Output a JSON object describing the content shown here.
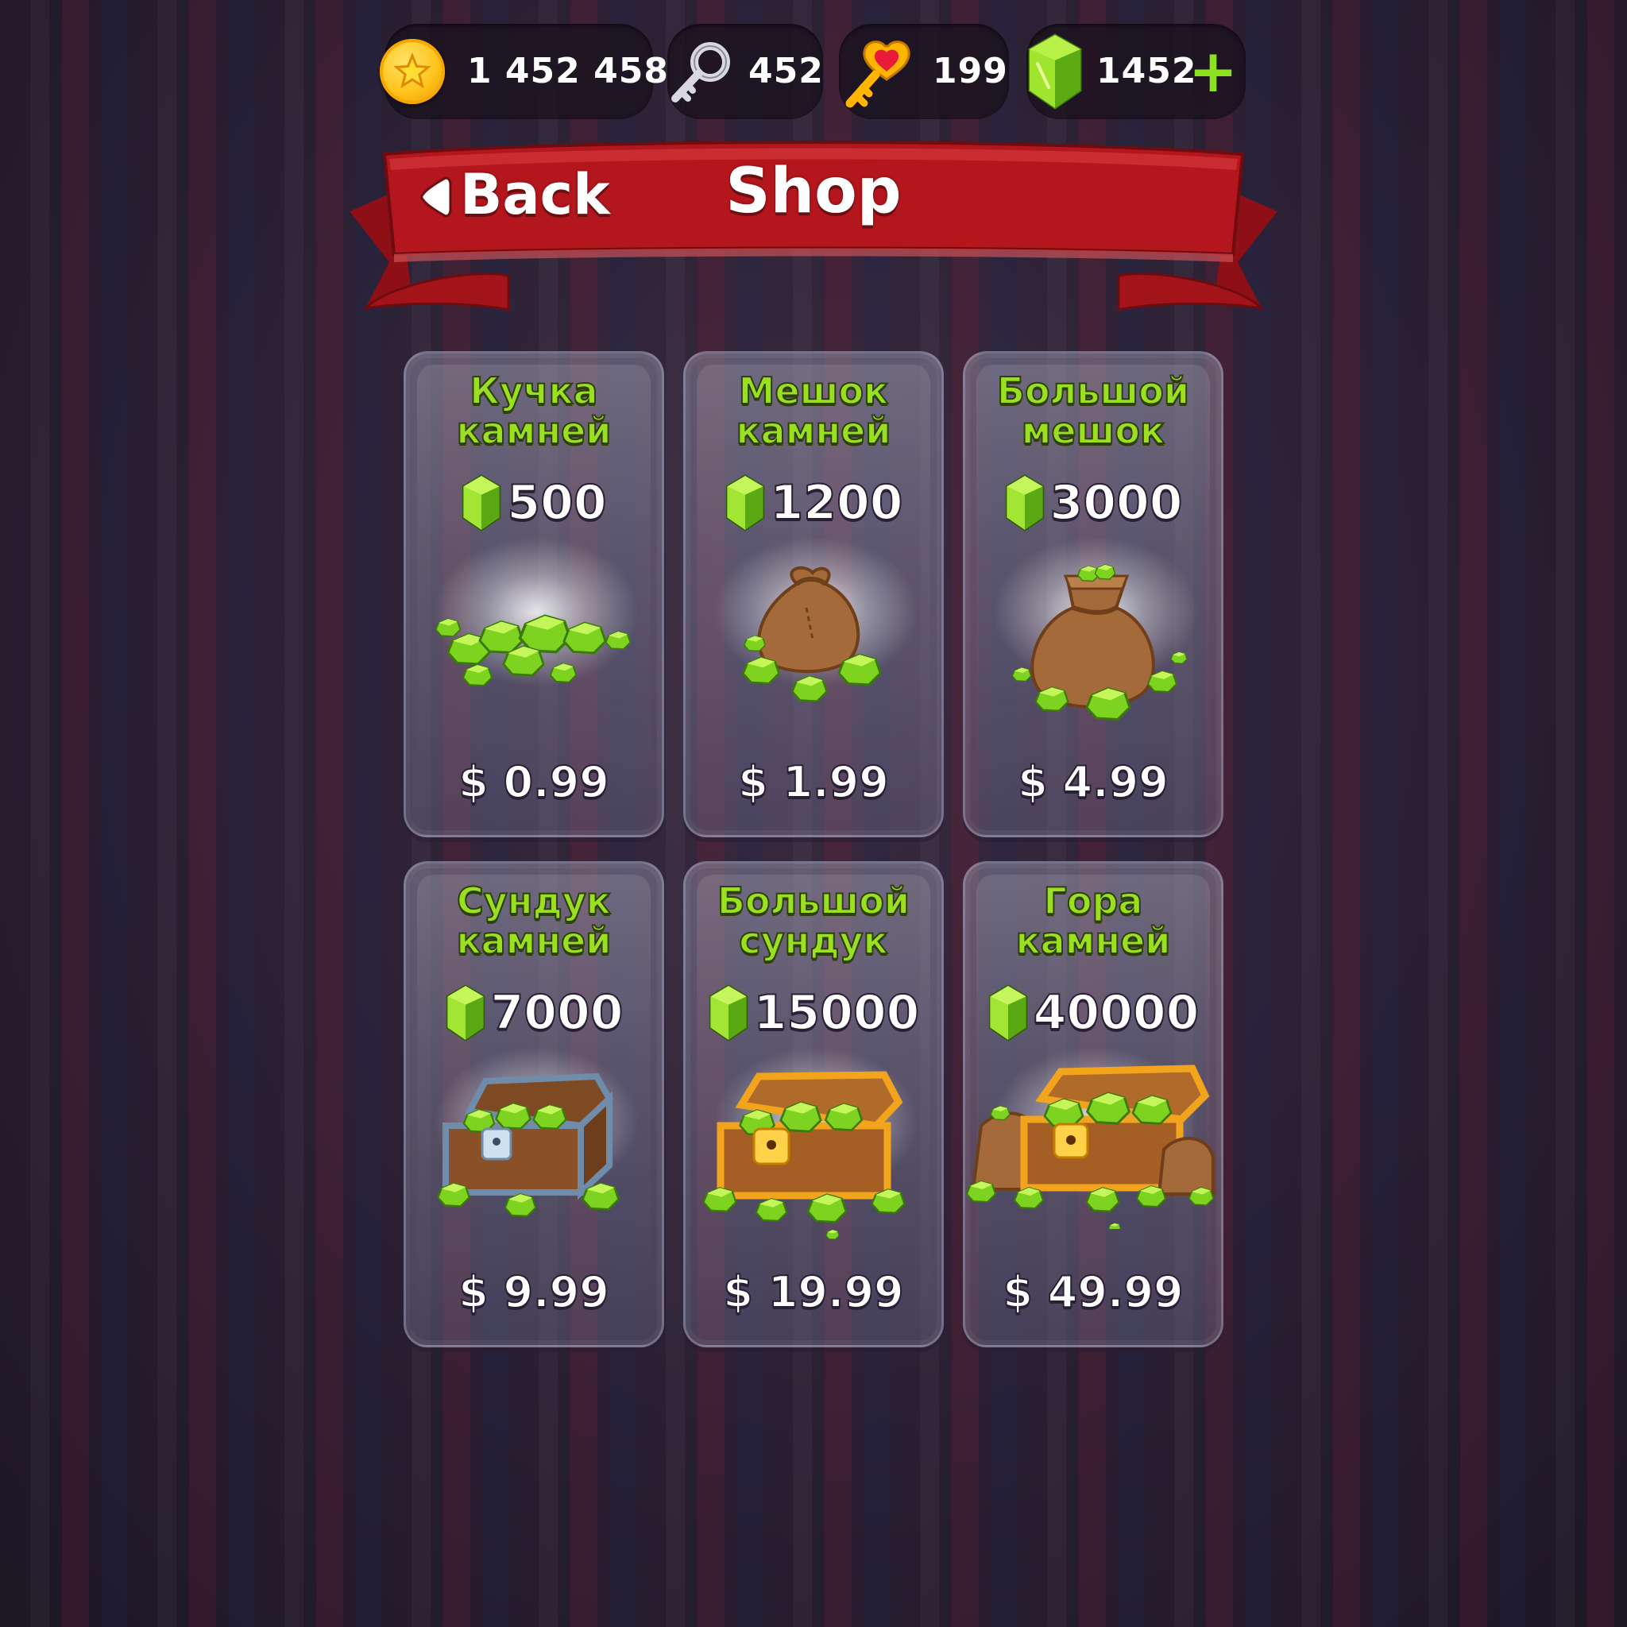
{
  "resources": {
    "coins": "1 452 458",
    "keys": "452",
    "heart_keys": "199",
    "gems": "1452",
    "add_label": "+"
  },
  "header": {
    "back_label": "Back",
    "title": "Shop"
  },
  "offers": [
    {
      "title_line1": "Кучка",
      "title_line2": "камней",
      "amount": "500",
      "price": "$ 0.99",
      "art": "gem-pile-icon"
    },
    {
      "title_line1": "Мешок",
      "title_line2": "камней",
      "amount": "1200",
      "price": "$ 1.99",
      "art": "gem-sack-icon"
    },
    {
      "title_line1": "Большой",
      "title_line2": "мешок",
      "amount": "3000",
      "price": "$ 4.99",
      "art": "big-gem-sack-icon"
    },
    {
      "title_line1": "Сундук",
      "title_line2": "камней",
      "amount": "7000",
      "price": "$ 9.99",
      "art": "silver-chest-icon"
    },
    {
      "title_line1": "Большой",
      "title_line2": "сундук",
      "amount": "15000",
      "price": "$ 19.99",
      "art": "gold-chest-icon"
    },
    {
      "title_line1": "Гора",
      "title_line2": "камней",
      "amount": "40000",
      "price": "$ 49.99",
      "art": "treasure-mountain-icon"
    }
  ],
  "colors": {
    "gem_green": "#8ee11f",
    "ribbon_red": "#b3161c",
    "title_green": "#9ae021"
  }
}
